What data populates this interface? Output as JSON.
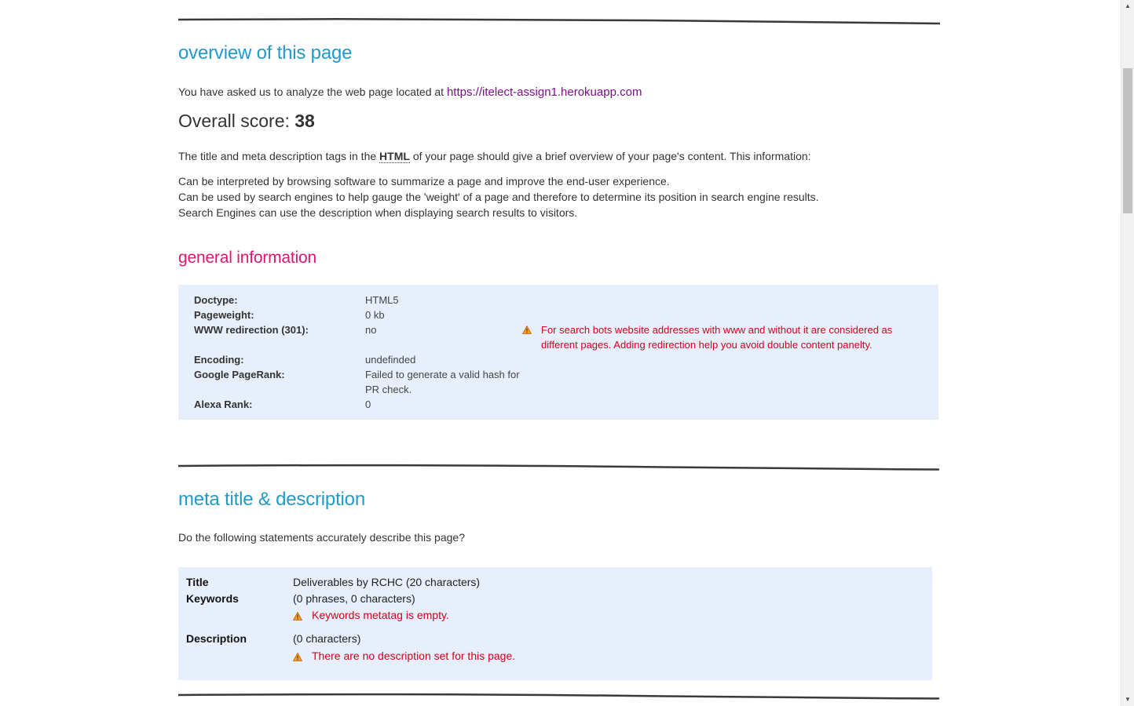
{
  "overview": {
    "heading": "overview of this page",
    "intro_text": "You have asked us to analyze the web page located at",
    "url": "https://itelect-assign1.herokuapp.com",
    "score_label": "Overall score:",
    "score_value": "38",
    "desc_before": "The title and meta description tags in the",
    "desc_abbr": "HTML",
    "desc_after": "of your page should give a brief overview of your page's content. This information:",
    "points": [
      "Can be interpreted by browsing software to summarize a page and improve the end-user experience.",
      "Can be used by search engines to help gauge the 'weight' of a page and therefore to determine its position in search engine results.",
      "Search Engines can use the description when displaying search results to visitors."
    ]
  },
  "general": {
    "heading": "general information",
    "rows": [
      {
        "key": "Doctype:",
        "value": "HTML5"
      },
      {
        "key": "Pageweight:",
        "value": "0 kb"
      },
      {
        "key": "WWW redirection (301):",
        "value": "no",
        "warning": "For search bots website addresses with www and without it are considered as different pages. Adding redirection help you avoid double content panelty."
      },
      {
        "key": "Encoding:",
        "value": "undefinded"
      },
      {
        "key": "Google PageRank:",
        "value": "Failed to generate a valid hash for PR check."
      },
      {
        "key": "Alexa Rank:",
        "value": "0"
      }
    ]
  },
  "meta": {
    "heading": "meta title & description",
    "question": "Do the following statements accurately describe this page?",
    "title_key": "Title",
    "title_value": "Deliverables by RCHC (20 characters)",
    "keywords_key": "Keywords",
    "keywords_value": "(0 phrases, 0 characters)",
    "keywords_warning": "Keywords metatag is empty.",
    "description_key": "Description",
    "description_value": "(0 characters)",
    "description_warning": "There are no description set for this page."
  },
  "colors": {
    "heading_blue": "#1f9ac9",
    "heading_pink": "#e0156f",
    "link": "#7a0f87",
    "warning": "#d0021b",
    "box_bg": "#e8effc"
  },
  "icons": [
    "warning-icon",
    "scroll-up-arrow-icon",
    "scroll-down-arrow-icon"
  ]
}
